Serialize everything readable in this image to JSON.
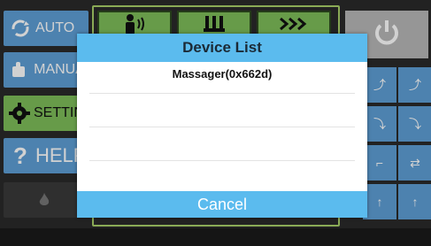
{
  "sidebar": {
    "auto_label": "AUTO",
    "manual_label": "MANUAL",
    "setting_label": "SETTING",
    "help_label": "HELP"
  },
  "dialog": {
    "title": "Device List",
    "devices": [
      "Massager(0x662d)"
    ],
    "cancel_label": "Cancel"
  },
  "colors": {
    "accent_blue": "#5bbbee",
    "side_blue": "#5e9fd6",
    "green": "#7ebd5a"
  }
}
